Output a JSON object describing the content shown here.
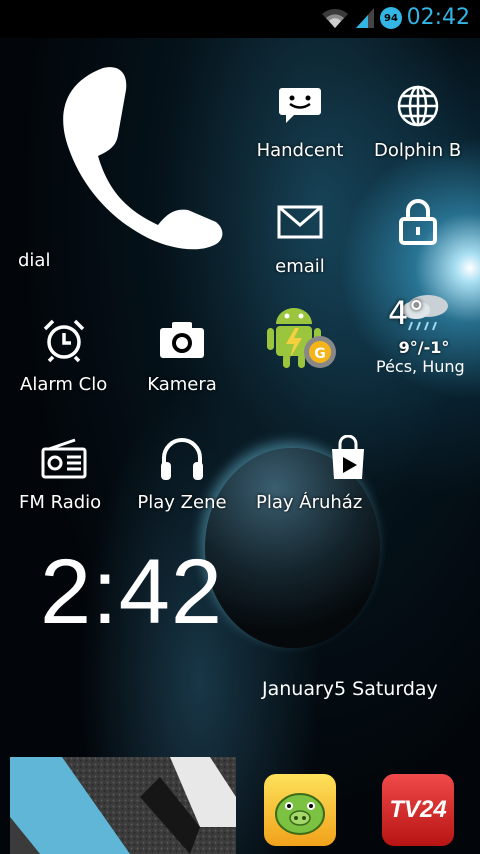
{
  "status_bar": {
    "time": "02:42",
    "battery_level": "94",
    "accent_color": "#33b5e5",
    "icons": [
      "wifi-icon",
      "signal-icon",
      "battery-icon"
    ]
  },
  "apps": {
    "dial": "dial",
    "handcent": "Handcent",
    "dolphin": "Dolphin B",
    "email": "email",
    "alarm": "Alarm Clo",
    "kamera": "Kamera",
    "fm_radio": "FM Radio",
    "play_zene": "Play Zene",
    "play_aruhaz": "Play Áruház"
  },
  "weather": {
    "temperature": "4°",
    "range": "9°/-1°",
    "location": "Pécs, Hung"
  },
  "clock_widget": {
    "time": "2:42",
    "date": "January5 Saturday"
  },
  "dock": {
    "tv24_label": "TV24",
    "icons": [
      "bad-piggies-icon",
      "tv24-icon"
    ]
  }
}
